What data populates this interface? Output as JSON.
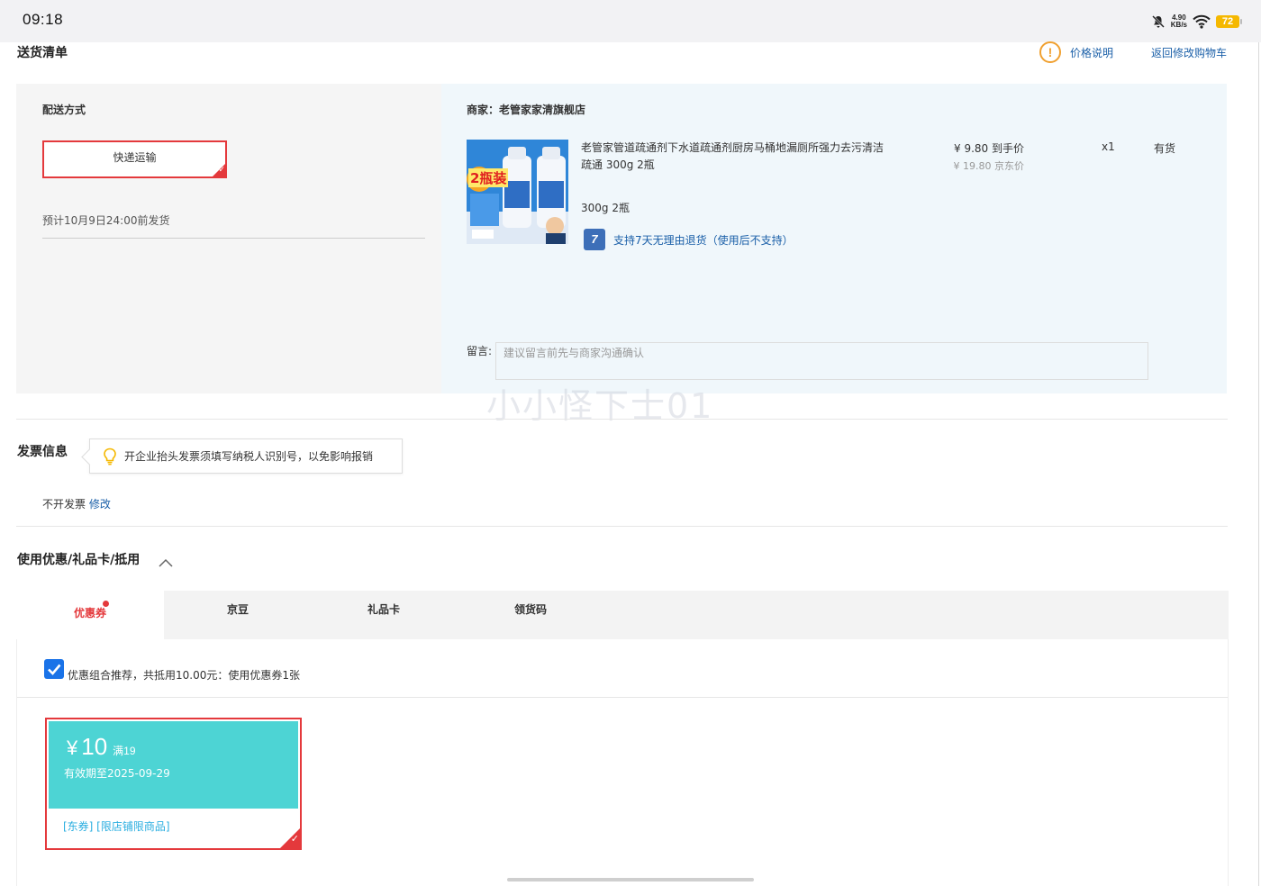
{
  "status_bar": {
    "time": "09:18",
    "net_speed_value": "4.90",
    "net_speed_unit": "KB/s",
    "battery": "72"
  },
  "delivery": {
    "title": "送货清单",
    "price_note_link": "价格说明",
    "back_to_cart_link": "返回修改购物车",
    "method_label": "配送方式",
    "method_selected": "快递运输",
    "ship_estimate": "预计10月9日24:00前发货",
    "merchant": "商家：老管家家清旗舰店",
    "product": {
      "thumbnail_label": "2瓶装",
      "title": "老管家管道疏通剂下水道疏通剂厨房马桶地漏厕所强力去污清洁疏通 300g 2瓶",
      "price": "¥ 9.80 到手价",
      "original_price": "¥ 19.80 京东价",
      "quantity": "x1",
      "stock": "有货",
      "spec": "300g 2瓶",
      "return_badge": "7",
      "return_policy": "支持7天无理由退货（使用后不支持）"
    },
    "message_label": "留言:",
    "message_placeholder": "建议留言前先与商家沟通确认",
    "message_value": ""
  },
  "watermark": "小小怪下士01",
  "invoice": {
    "title": "发票信息",
    "tip": "开企业抬头发票须填写纳税人识别号，以免影响报销",
    "value": "不开发票",
    "edit_link": "修改"
  },
  "discounts": {
    "title": "使用优惠/礼品卡/抵用",
    "tabs": [
      {
        "label": "优惠券"
      },
      {
        "label": "京豆"
      },
      {
        "label": "礼品卡"
      },
      {
        "label": "领货码"
      }
    ],
    "combo_checked": true,
    "combo_text": "优惠组合推荐，共抵用10.00元：使用优惠券1张",
    "coupon": {
      "currency": "¥",
      "amount": "10",
      "condition": "满19",
      "expiry": "有效期至2025-09-29",
      "tags": "[东券]  [限店铺限商品]"
    }
  },
  "colors": {
    "accent_red": "#e4393c",
    "link_blue": "#1a5fa8",
    "coupon_teal": "#4dd4d4"
  }
}
